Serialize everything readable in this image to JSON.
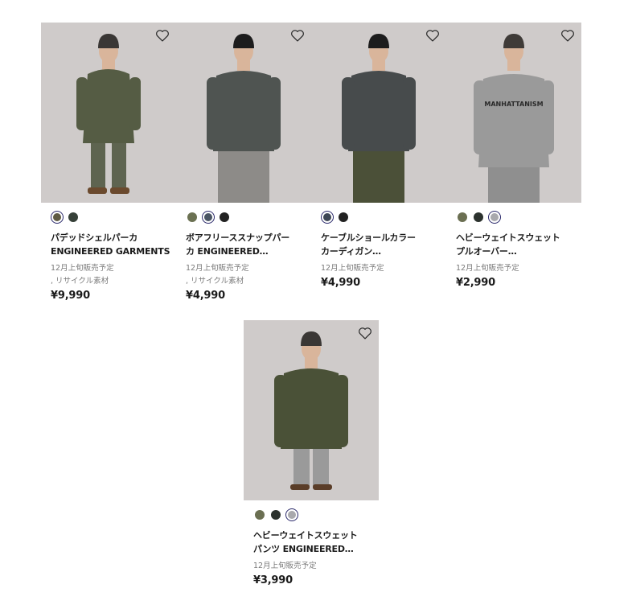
{
  "products": [
    {
      "name_lines": [
        "パデッドシェルパーカ",
        "ENGINEERED GARMENTS"
      ],
      "notes": [
        "12月上旬販売予定",
        ", リサイクル素材"
      ],
      "price": "¥9,990",
      "swatches": [
        {
          "color": "#5f5b44",
          "selected": true
        },
        {
          "color": "#364038",
          "selected": false
        }
      ],
      "garment": {
        "top": "#555c44",
        "bottom": "#5e6450",
        "hat": "#3a3735",
        "length": "long"
      }
    },
    {
      "name_lines": [
        "ボアフリーススナップパー",
        "カ ENGINEERED…"
      ],
      "notes": [
        "12月上旬販売予定",
        ", リサイクル素材"
      ],
      "price": "¥4,990",
      "swatches": [
        {
          "color": "#6b7152",
          "selected": false
        },
        {
          "color": "#4a5563",
          "selected": true
        },
        {
          "color": "#222222",
          "selected": false
        }
      ],
      "garment": {
        "top": "#4f5451",
        "bottom": "#8d8b88",
        "hat": "#1d1d1d",
        "length": "short"
      }
    },
    {
      "name_lines": [
        "ケーブルショールカラー",
        "カーディガン…"
      ],
      "notes": [
        "12月上旬販売予定"
      ],
      "price": "¥4,990",
      "swatches": [
        {
          "color": "#3d4654",
          "selected": true
        },
        {
          "color": "#222222",
          "selected": false
        }
      ],
      "garment": {
        "top": "#474b4c",
        "bottom": "#4b5038",
        "hat": "#1d1d1d",
        "length": "short"
      }
    },
    {
      "name_lines": [
        "ヘビーウェイトスウェット",
        "プルオーバー…"
      ],
      "notes": [
        "12月上旬販売予定"
      ],
      "price": "¥2,990",
      "swatches": [
        {
          "color": "#6b6f52",
          "selected": false
        },
        {
          "color": "#2c322e",
          "selected": false
        },
        {
          "color": "#a9a9ad",
          "selected": true
        }
      ],
      "garment": {
        "top": "#9a9a9a",
        "bottom": "#8f8f8f",
        "hat": "#3f3b38",
        "length": "sweat",
        "print": "MANHATTANISM"
      }
    },
    {
      "name_lines": [
        "ヘビーウェイトスウェット",
        "パンツ ENGINEERED…"
      ],
      "notes": [
        "12月上旬販売予定"
      ],
      "price": "¥3,990",
      "swatches": [
        {
          "color": "#6b6f52",
          "selected": false
        },
        {
          "color": "#2c322e",
          "selected": false
        },
        {
          "color": "#a9a9ad",
          "selected": true
        }
      ],
      "garment": {
        "top": "#4a5137",
        "bottom": "#9a9a9a",
        "hat": "#3a3735",
        "length": "short"
      }
    }
  ]
}
